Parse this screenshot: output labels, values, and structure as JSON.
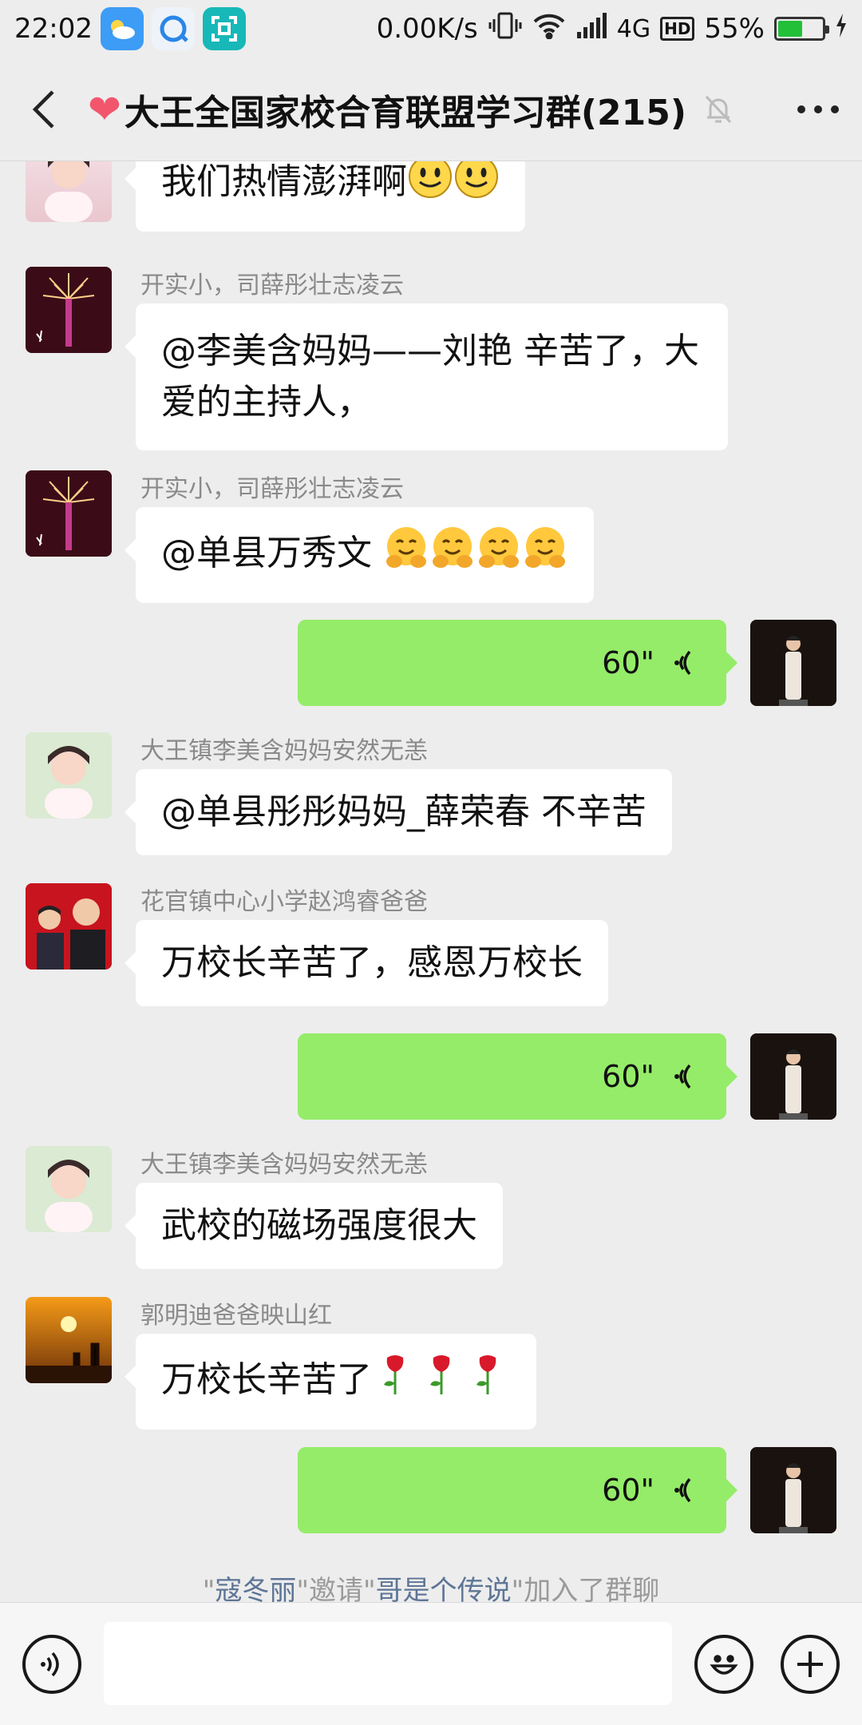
{
  "status_bar": {
    "time": "22:02",
    "net_speed": "0.00K/s",
    "network": "4G",
    "hd": "HD",
    "battery": "55%",
    "battery_level": 0.55
  },
  "header": {
    "title": "大王全国家校合育联盟学习群(215)"
  },
  "messages": [
    {
      "type": "text",
      "side": "left",
      "sender": "",
      "text": "我们热情澎湃啊",
      "emojis": [
        "smile",
        "smile"
      ],
      "avatar": "girl-avatar"
    },
    {
      "type": "text",
      "side": "left",
      "sender": "开实小，司薛彤壮志凌云",
      "lines": [
        "@李美含妈妈——刘艳  辛苦了，大",
        "爱的主持人，"
      ],
      "avatar": "fireworks-avatar"
    },
    {
      "type": "text",
      "side": "left",
      "sender": "开实小，司薛彤壮志凌云",
      "text": "@单县万秀文 ",
      "emojis": [
        "hug",
        "hug",
        "hug",
        "hug"
      ],
      "avatar": "fireworks-avatar"
    },
    {
      "type": "voice",
      "side": "right",
      "duration": "60\"",
      "avatar": "woman-avatar"
    },
    {
      "type": "text",
      "side": "left",
      "sender": "大王镇李美含妈妈安然无恙",
      "text": "@单县彤彤妈妈_薛荣春  不辛苦",
      "avatar": "girl-avatar"
    },
    {
      "type": "text",
      "side": "left",
      "sender": "花官镇中心小学赵鸿睿爸爸",
      "text": "万校长辛苦了，感恩万校长",
      "avatar": "father-son-avatar"
    },
    {
      "type": "voice",
      "side": "right",
      "duration": "60\"",
      "avatar": "woman-avatar"
    },
    {
      "type": "text",
      "side": "left",
      "sender": "大王镇李美含妈妈安然无恙",
      "text": "武校的磁场强度很大",
      "avatar": "girl-avatar"
    },
    {
      "type": "text",
      "side": "left",
      "sender": "郭明迪爸爸映山红",
      "text": "万校长辛苦了",
      "emojis": [
        "rose",
        "rose",
        "rose"
      ],
      "avatar": "sunset-avatar"
    },
    {
      "type": "voice",
      "side": "right",
      "duration": "60\"",
      "avatar": "woman-avatar"
    }
  ],
  "system_note": {
    "q1": "\"",
    "inviter": "寇冬丽",
    "mid": "\"邀请\"",
    "invitee": "哥是个传说",
    "end": "\"加入了群聊"
  },
  "input": {
    "value": "",
    "placeholder": ""
  },
  "icons": {
    "back": "chevron-left-icon",
    "mute": "bell-off-icon",
    "more": "more-dots-icon",
    "voice_toggle": "voice-input-icon",
    "emoji": "emoji-icon",
    "plus": "plus-icon"
  },
  "colors": {
    "background": "#ededed",
    "bubble_self": "#95ec69",
    "bubble_other": "#ffffff",
    "sender_name": "#8a8a8a",
    "link_name": "#5e7596"
  }
}
